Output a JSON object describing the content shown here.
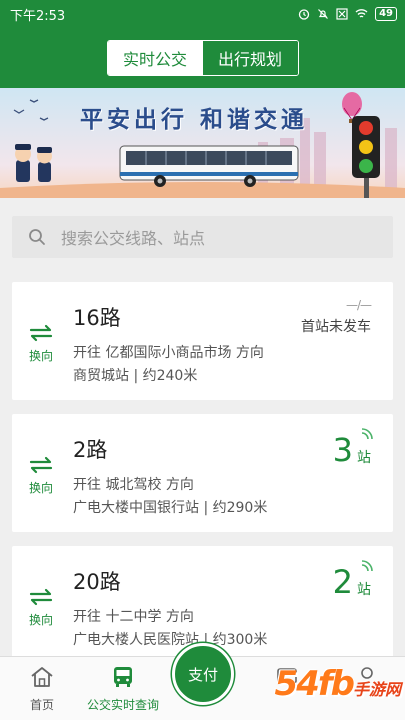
{
  "status": {
    "time": "下午2:53",
    "battery": "49"
  },
  "tabs": {
    "active": "实时公交",
    "inactive": "出行规划"
  },
  "banner": {
    "title": "平安出行 和谐交通"
  },
  "search": {
    "placeholder": "搜索公交线路、站点"
  },
  "routes": [
    {
      "name": "16路",
      "swap_label": "换向",
      "direction": "开往 亿都国际小商品市场 方向",
      "stop": "商贸城站 | 约240米",
      "arrival_dash": "—/—",
      "arrival_text": "首站未发车"
    },
    {
      "name": "2路",
      "swap_label": "换向",
      "direction": "开往 城北驾校 方向",
      "stop": "广电大楼中国银行站 | 约290米",
      "arrival_count": "3",
      "arrival_unit": "站"
    },
    {
      "name": "20路",
      "swap_label": "换向",
      "direction": "开往 十二中学 方向",
      "stop": "广电大楼人民医院站 | 约300米",
      "arrival_count": "2",
      "arrival_unit": "站"
    }
  ],
  "nav": {
    "home": "首页",
    "realtime": "公交实时查询",
    "pay": "支付"
  },
  "watermark": {
    "main": "54fb",
    "sub": "手游网"
  },
  "colors": {
    "primary": "#1f8b3b"
  }
}
